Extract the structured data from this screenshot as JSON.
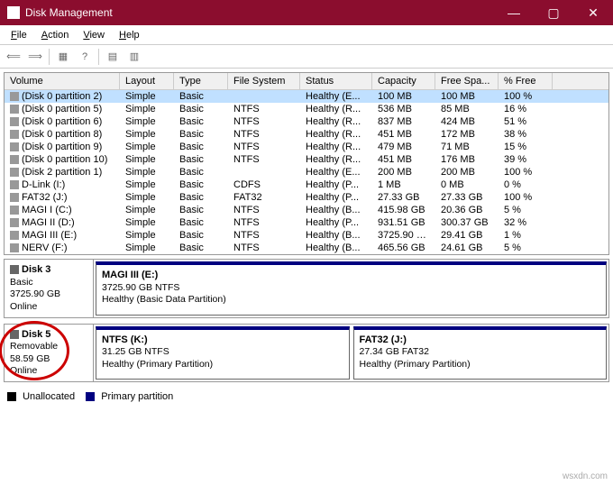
{
  "titlebar": {
    "title": "Disk Management"
  },
  "menu": {
    "file": "File",
    "action": "Action",
    "view": "View",
    "help": "Help"
  },
  "columns": {
    "volume": "Volume",
    "layout": "Layout",
    "type": "Type",
    "fs": "File System",
    "status": "Status",
    "capacity": "Capacity",
    "free": "Free Spa...",
    "pfree": "% Free"
  },
  "volumes": [
    {
      "name": "(Disk 0 partition 2)",
      "layout": "Simple",
      "type": "Basic",
      "fs": "",
      "status": "Healthy (E...",
      "capacity": "100 MB",
      "free": "100 MB",
      "pfree": "100 %",
      "sel": true
    },
    {
      "name": "(Disk 0 partition 5)",
      "layout": "Simple",
      "type": "Basic",
      "fs": "NTFS",
      "status": "Healthy (R...",
      "capacity": "536 MB",
      "free": "85 MB",
      "pfree": "16 %"
    },
    {
      "name": "(Disk 0 partition 6)",
      "layout": "Simple",
      "type": "Basic",
      "fs": "NTFS",
      "status": "Healthy (R...",
      "capacity": "837 MB",
      "free": "424 MB",
      "pfree": "51 %"
    },
    {
      "name": "(Disk 0 partition 8)",
      "layout": "Simple",
      "type": "Basic",
      "fs": "NTFS",
      "status": "Healthy (R...",
      "capacity": "451 MB",
      "free": "172 MB",
      "pfree": "38 %"
    },
    {
      "name": "(Disk 0 partition 9)",
      "layout": "Simple",
      "type": "Basic",
      "fs": "NTFS",
      "status": "Healthy (R...",
      "capacity": "479 MB",
      "free": "71 MB",
      "pfree": "15 %"
    },
    {
      "name": "(Disk 0 partition 10)",
      "layout": "Simple",
      "type": "Basic",
      "fs": "NTFS",
      "status": "Healthy (R...",
      "capacity": "451 MB",
      "free": "176 MB",
      "pfree": "39 %"
    },
    {
      "name": "(Disk 2 partition 1)",
      "layout": "Simple",
      "type": "Basic",
      "fs": "",
      "status": "Healthy (E...",
      "capacity": "200 MB",
      "free": "200 MB",
      "pfree": "100 %"
    },
    {
      "name": "D-Link (I:)",
      "layout": "Simple",
      "type": "Basic",
      "fs": "CDFS",
      "status": "Healthy (P...",
      "capacity": "1 MB",
      "free": "0 MB",
      "pfree": "0 %"
    },
    {
      "name": "FAT32 (J:)",
      "layout": "Simple",
      "type": "Basic",
      "fs": "FAT32",
      "status": "Healthy (P...",
      "capacity": "27.33 GB",
      "free": "27.33 GB",
      "pfree": "100 %"
    },
    {
      "name": "MAGI I (C:)",
      "layout": "Simple",
      "type": "Basic",
      "fs": "NTFS",
      "status": "Healthy (B...",
      "capacity": "415.98 GB",
      "free": "20.36 GB",
      "pfree": "5 %"
    },
    {
      "name": "MAGI II (D:)",
      "layout": "Simple",
      "type": "Basic",
      "fs": "NTFS",
      "status": "Healthy (P...",
      "capacity": "931.51 GB",
      "free": "300.37 GB",
      "pfree": "32 %"
    },
    {
      "name": "MAGI III (E:)",
      "layout": "Simple",
      "type": "Basic",
      "fs": "NTFS",
      "status": "Healthy (B...",
      "capacity": "3725.90 GB",
      "free": "29.41 GB",
      "pfree": "1 %"
    },
    {
      "name": "NERV (F:)",
      "layout": "Simple",
      "type": "Basic",
      "fs": "NTFS",
      "status": "Healthy (B...",
      "capacity": "465.56 GB",
      "free": "24.61 GB",
      "pfree": "5 %"
    }
  ],
  "disks": [
    {
      "label": "Disk 3",
      "kind": "Basic",
      "size": "3725.90 GB",
      "state": "Online",
      "parts": [
        {
          "title": "MAGI III  (E:)",
          "line2": "3725.90 GB NTFS",
          "line3": "Healthy (Basic Data Partition)"
        }
      ]
    },
    {
      "label": "Disk 5",
      "kind": "Removable",
      "size": "58.59 GB",
      "state": "Online",
      "circled": true,
      "parts": [
        {
          "title": "NTFS  (K:)",
          "line2": "31.25 GB NTFS",
          "line3": "Healthy (Primary Partition)"
        },
        {
          "title": "FAT32  (J:)",
          "line2": "27.34 GB FAT32",
          "line3": "Healthy (Primary Partition)"
        }
      ]
    }
  ],
  "legend": {
    "unallocated": "Unallocated",
    "unallocated_color": "#000000",
    "primary": "Primary partition",
    "primary_color": "#000080"
  },
  "watermark": "wsxdn.com"
}
